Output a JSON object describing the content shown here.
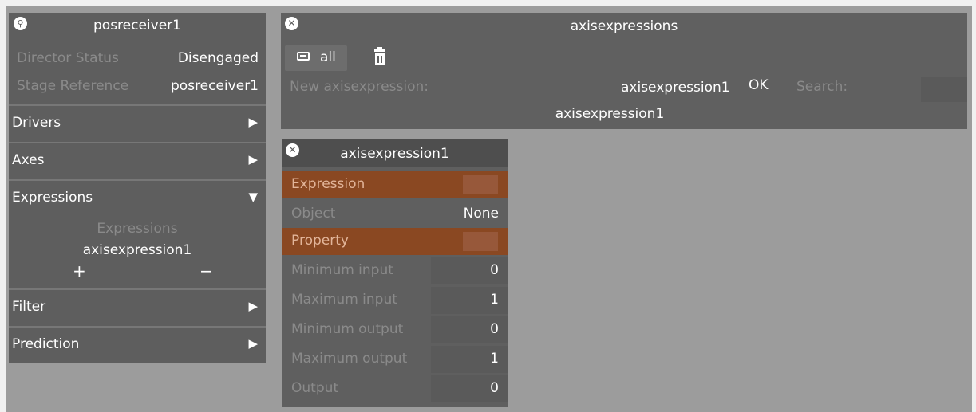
{
  "left_panel": {
    "title": "posreceiver1",
    "director_status": {
      "label": "Director Status",
      "value": "Disengaged"
    },
    "stage_reference": {
      "label": "Stage Reference",
      "value": "posreceiver1"
    },
    "sections": {
      "drivers": {
        "label": "Drivers",
        "arrow": "▶"
      },
      "axes": {
        "label": "Axes",
        "arrow": "▶"
      },
      "expressions": {
        "label": "Expressions",
        "arrow": "▼"
      },
      "filter": {
        "label": "Filter",
        "arrow": "▶"
      },
      "prediction": {
        "label": "Prediction",
        "arrow": "▶"
      }
    },
    "expressions_list": {
      "header": "Expressions",
      "items": [
        "axisexpression1"
      ],
      "add": "+",
      "remove": "−"
    }
  },
  "axisexpressions_panel": {
    "title": "axisexpressions",
    "all_button": "all",
    "new_label": "New axisexpression:",
    "new_value": "axisexpression1",
    "ok_button": "OK",
    "search_label": "Search:",
    "items": [
      "axisexpression1"
    ]
  },
  "axisexpression_panel": {
    "title": "axisexpression1",
    "rows": {
      "expression": {
        "label": "Expression",
        "value": ""
      },
      "object": {
        "label": "Object",
        "value": "None"
      },
      "property": {
        "label": "Property",
        "value": ""
      },
      "min_input": {
        "label": "Minimum input",
        "value": "0"
      },
      "max_input": {
        "label": "Maximum input",
        "value": "1"
      },
      "min_output": {
        "label": "Minimum output",
        "value": "0"
      },
      "max_output": {
        "label": "Maximum output",
        "value": "1"
      },
      "output": {
        "label": "Output",
        "value": "0"
      }
    }
  },
  "icons": {
    "close": "close-icon",
    "location": "location-pin-icon",
    "all": "list-icon",
    "trash": "trash-icon"
  },
  "colors": {
    "canvas": "#9c9c9c",
    "panel": "#606060",
    "highlight_row": "#8a4822",
    "swatch": "#97583a"
  }
}
